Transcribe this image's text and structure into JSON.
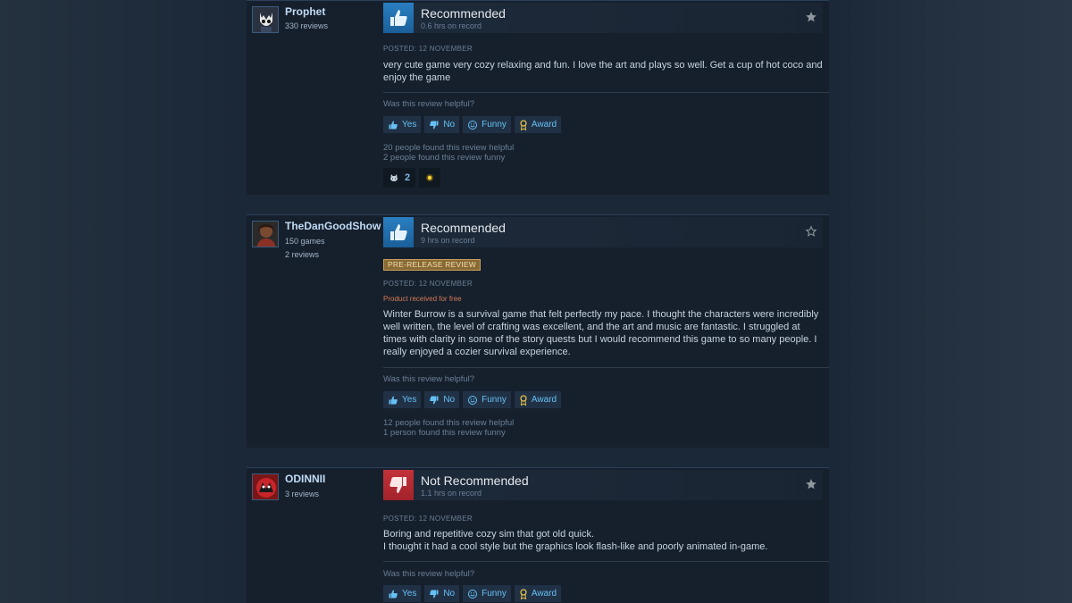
{
  "reviews": [
    {
      "author": {
        "name": "Prophet",
        "meta_lines": [
          "330 reviews"
        ]
      },
      "verdict": "Recommended",
      "hours": "0.6 hrs on record",
      "posted": "POSTED: 12 NOVEMBER",
      "text": "very cute game very cozy relaxing and fun. I love the art and plays so well. Get a cup of hot coco and enjoy the game",
      "helpful_question": "Was this review helpful?",
      "buttons": {
        "yes": "Yes",
        "no": "No",
        "funny": "Funny",
        "award": "Award"
      },
      "stats": [
        "20 people found this review helpful",
        "2 people found this review funny"
      ],
      "awards": [
        {
          "icon": "cat-award-icon",
          "count": "2"
        },
        {
          "icon": "glow-award-icon",
          "count": ""
        }
      ]
    },
    {
      "author": {
        "name": "TheDanGoodShow",
        "meta_lines": [
          "150 games",
          "2 reviews"
        ]
      },
      "verdict": "Recommended",
      "hours": "9 hrs on record",
      "badge": "PRE-RELEASE REVIEW",
      "posted": "POSTED: 12 NOVEMBER",
      "free_note": "Product received for free",
      "text": "Winter Burrow is a survival game that felt perfectly my pace. I thought the characters were incredibly well written, the level of crafting was excellent, and the art and music are fantastic. I struggled at times with clarity in some of the story quests but I would recommend this game to so many people. I really enjoyed a cozier survival experience.",
      "helpful_question": "Was this review helpful?",
      "buttons": {
        "yes": "Yes",
        "no": "No",
        "funny": "Funny",
        "award": "Award"
      },
      "stats": [
        "12 people found this review helpful",
        "1 person found this review funny"
      ]
    },
    {
      "author": {
        "name": "ODINNII",
        "meta_lines": [
          "3 reviews"
        ]
      },
      "verdict": "Not Recommended",
      "hours": "1.1 hrs on record",
      "posted": "POSTED: 12 NOVEMBER",
      "text_lines": [
        "Boring and repetitive cozy sim that got old quick.",
        "I thought it had a cool style but the graphics look flash-like and poorly animated in-game."
      ],
      "helpful_question": "Was this review helpful?",
      "buttons": {
        "yes": "Yes",
        "no": "No",
        "funny": "Funny",
        "award": "Award"
      }
    }
  ],
  "colors": {
    "page_bg": "#1b2838",
    "card_bg": "#16202d",
    "positive_thumb": "#2a7fc1",
    "negative_thumb": "#c3323a",
    "link_blue": "#66c0f4",
    "free_note": "#d37a55"
  }
}
